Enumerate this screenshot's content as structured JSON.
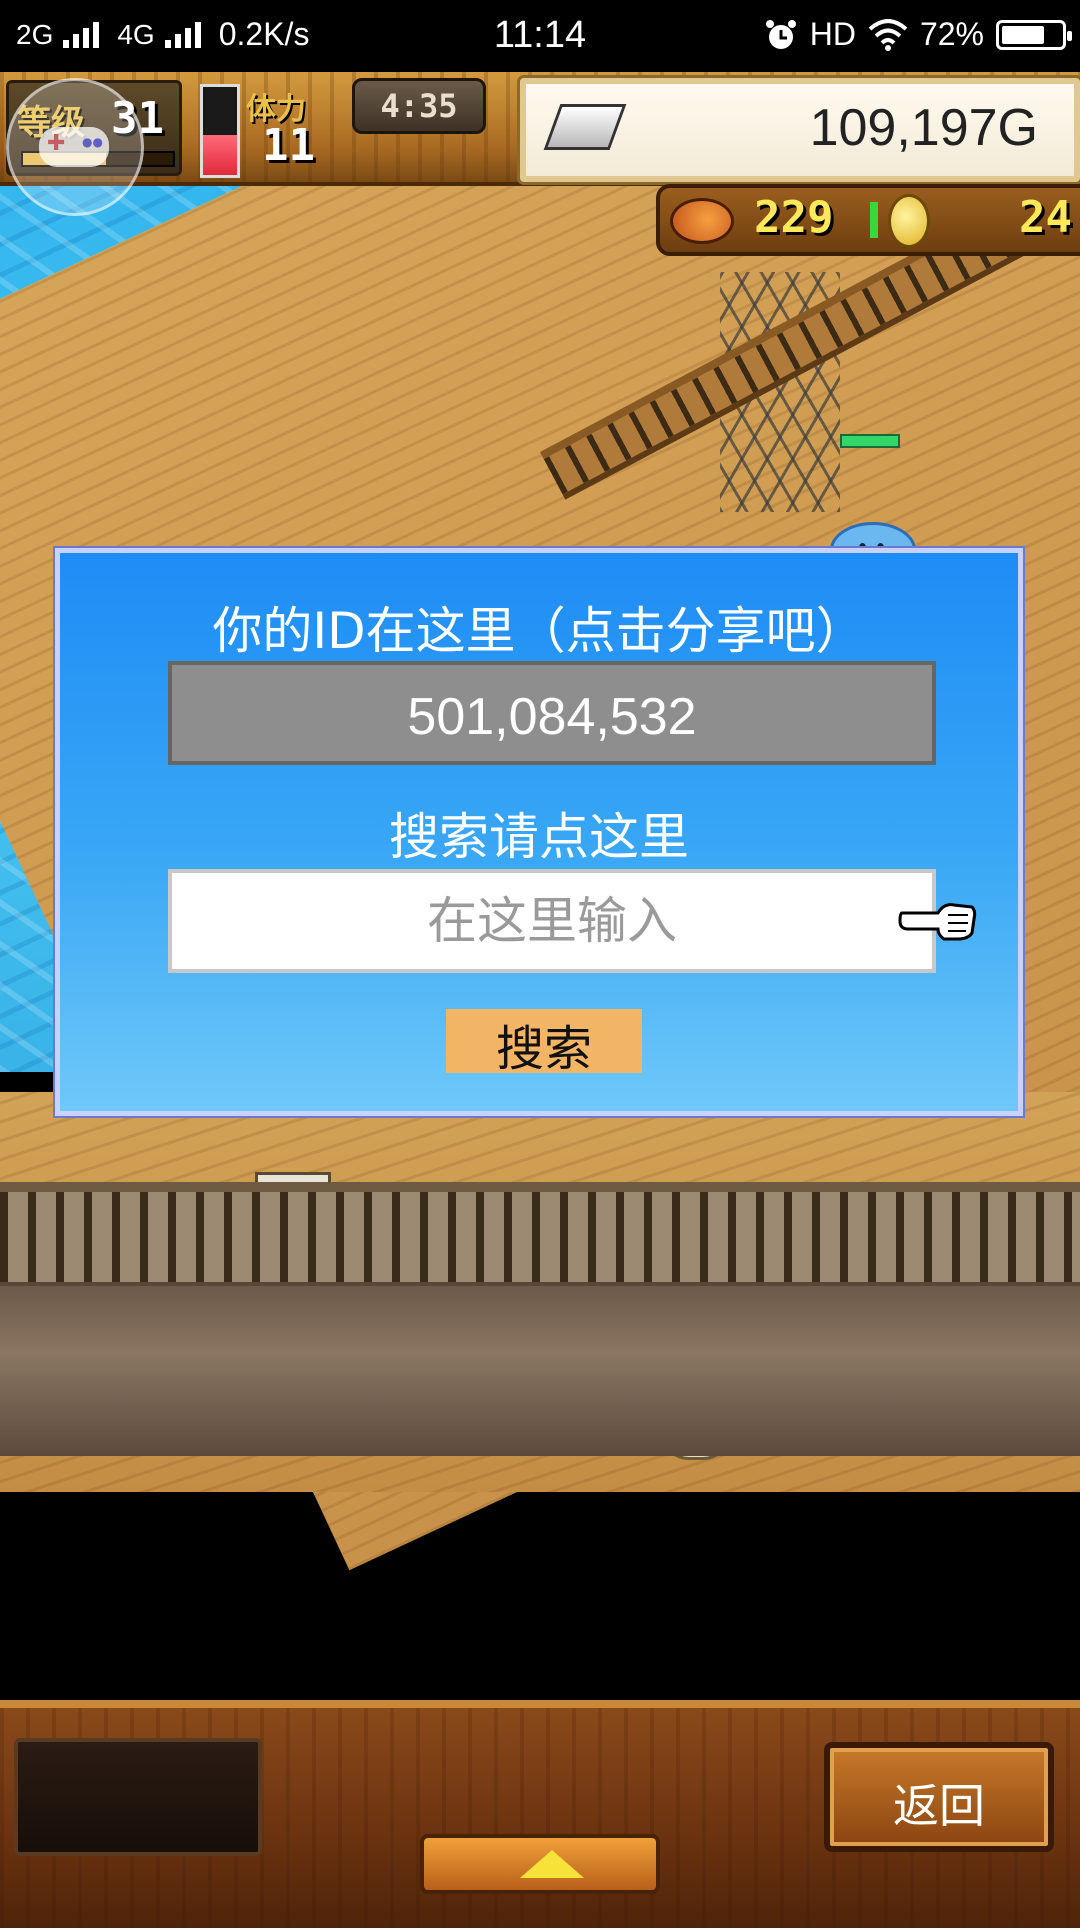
{
  "status_bar": {
    "network_1": "2G",
    "network_2": "4G",
    "speed": "0.2K/s",
    "time": "11:14",
    "hd": "HD",
    "battery": "72%",
    "battery_level": 0.72,
    "icons": [
      "signal-icon",
      "alarm-icon",
      "wifi-icon",
      "battery-icon"
    ]
  },
  "hud": {
    "level_label": "等级",
    "level": "31",
    "stamina_label": "体力",
    "stamina": "11",
    "stamina_fill": 0.45,
    "timer": "4:35",
    "gold": "109,197G",
    "food": "229",
    "coins": "24"
  },
  "dialog": {
    "title": "你的ID在这里（点击分享吧）",
    "player_id": "501,084,532",
    "search_label": "搜索请点这里",
    "search_placeholder": "在这里输入",
    "search_value": "",
    "search_button": "搜索"
  },
  "bottom": {
    "back_button": "返回"
  },
  "colors": {
    "dialog_top": "#1e8cf5",
    "dialog_bottom": "#6fc8f8",
    "search_button": "#f2b565",
    "id_box": "#8e8e8e",
    "sea": "#39b3e8",
    "deck": "#c8924a"
  }
}
